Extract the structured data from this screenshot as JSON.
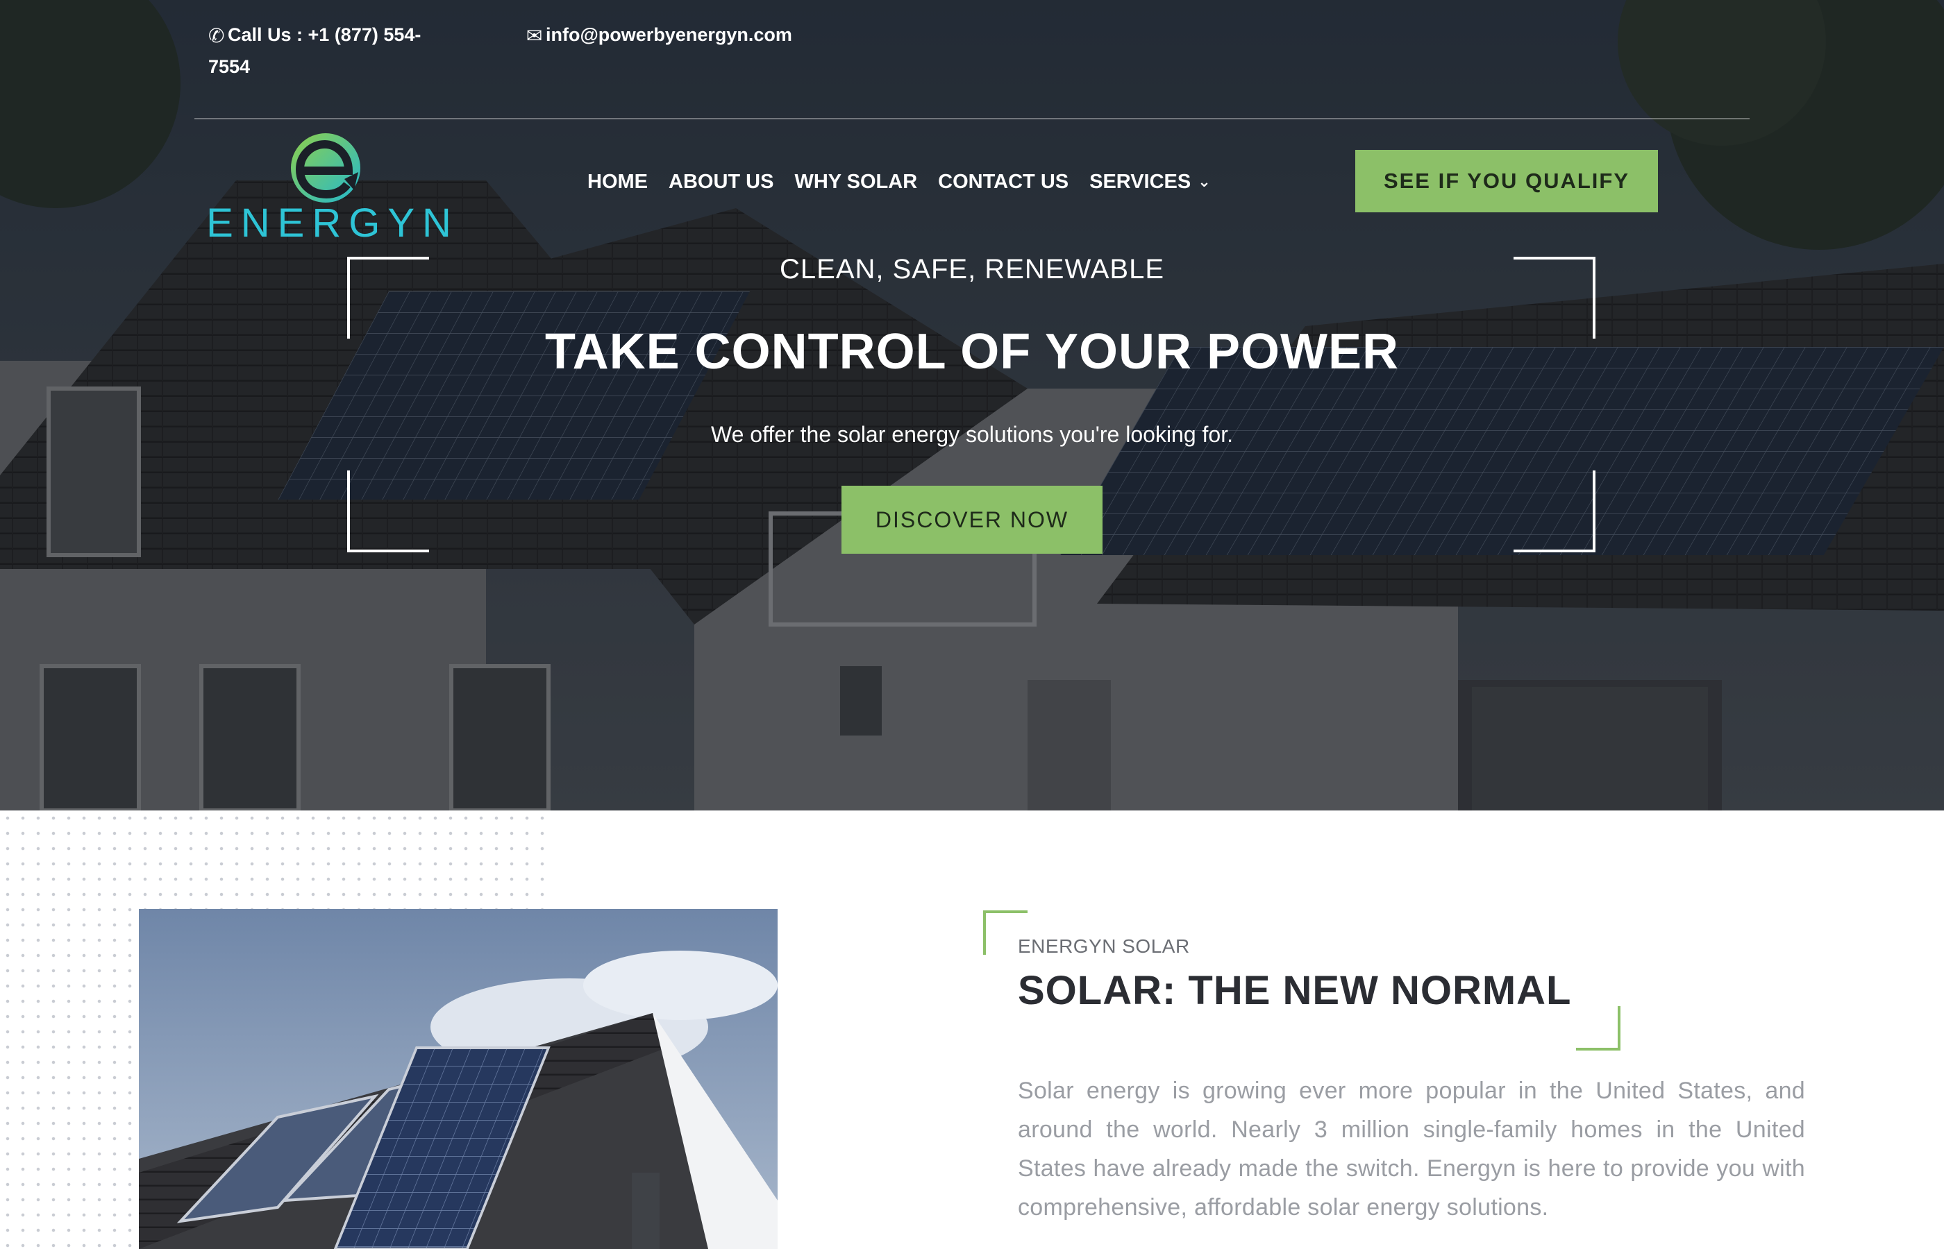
{
  "topbar": {
    "phone_icon": "phone-icon",
    "phone": "Call Us : +1 (877) 554-7554",
    "email_icon": "envelope-icon",
    "email": "info@powerbyenergyn.com"
  },
  "brand": {
    "logo_text": "ENERGYN"
  },
  "nav": {
    "items": [
      "HOME",
      "ABOUT US",
      "WHY SOLAR",
      "CONTACT US",
      "SERVICES"
    ],
    "services_chevron": "chevron-down-icon"
  },
  "cta": {
    "qualify": "SEE IF YOU QUALIFY"
  },
  "hero": {
    "eyebrow": "CLEAN, SAFE, RENEWABLE",
    "title": "TAKE CONTROL OF YOUR POWER",
    "subtitle": "We offer the solar energy solutions you're looking for.",
    "button": "DISCOVER NOW"
  },
  "intro": {
    "eyebrow": "ENERGYN SOLAR",
    "title": "SOLAR: THE NEW NORMAL",
    "body": "Solar energy is growing ever more popular in the United States, and around the world. Nearly 3 million single-family homes in the United States have already made the switch. Energyn is here to provide you with comprehensive, affordable solar energy solutions."
  },
  "colors": {
    "accent": "#8cc068",
    "logo_cyan": "#2ec4d6",
    "logo_green": "#7cc95a",
    "text_dark": "#2b2d33",
    "text_muted": "#9a9da3"
  }
}
